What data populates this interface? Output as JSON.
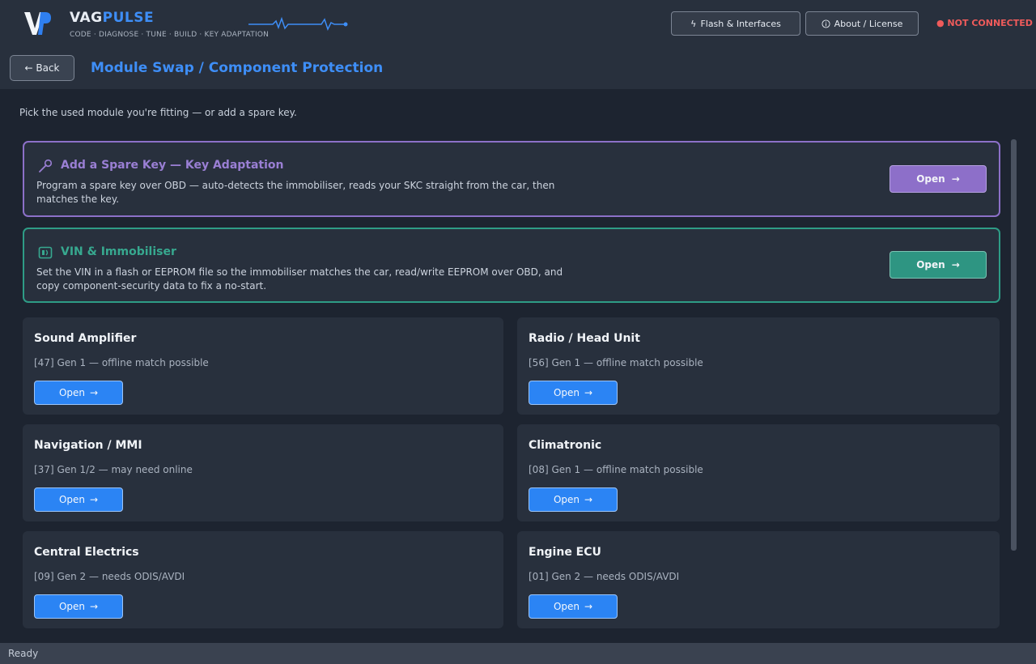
{
  "header": {
    "brand_part1": "VAG",
    "brand_part2": "PULSE",
    "tagline": "CODE · DIAGNOSE · TUNE · BUILD · KEY ADAPTATION",
    "flash_button": "Flash & Interfaces",
    "about_button": "About / License",
    "connection_status": "● NOT CONNECTED",
    "logo": "vp-logo",
    "pulse_graphic": "heartbeat-line"
  },
  "nav": {
    "back_label": "← Back",
    "page_title": "Module Swap / Component Protection"
  },
  "intro": "Pick the used module you're fitting — or add a spare key.",
  "features": [
    {
      "title": "Add a Spare Key — Key Adaptation",
      "description": "Program a spare key over OBD — auto-detects the immobiliser, reads your SKC straight from the car, then matches the key.",
      "button": "Open",
      "arrow": "→",
      "icon": "wrench-icon"
    },
    {
      "title": "VIN & Immobiliser",
      "description": "Set the VIN in a flash or EEPROM file so the immobiliser matches the car, read/write EEPROM over OBD, and copy component-security data to fix a no-start.",
      "button": "Open",
      "arrow": "→",
      "icon": "id-card-icon"
    }
  ],
  "modules": [
    {
      "title": "Sound Amplifier",
      "description": "[47] Gen 1 — offline match possible",
      "button": "Open",
      "arrow": "→"
    },
    {
      "title": "Radio / Head Unit",
      "description": "[56] Gen 1 — offline match possible",
      "button": "Open",
      "arrow": "→"
    },
    {
      "title": "Navigation / MMI",
      "description": "[37] Gen 1/2 — may need online",
      "button": "Open",
      "arrow": "→"
    },
    {
      "title": "Climatronic",
      "description": "[08] Gen 1 — offline match possible",
      "button": "Open",
      "arrow": "→"
    },
    {
      "title": "Central Electrics",
      "description": "[09] Gen 2 — needs ODIS/AVDI",
      "button": "Open",
      "arrow": "→"
    },
    {
      "title": "Engine ECU",
      "description": "[01] Gen 2 — needs ODIS/AVDI",
      "button": "Open",
      "arrow": "→"
    }
  ],
  "status_bar": "Ready",
  "colors": {
    "accent": "#3e8ef7",
    "key_feature": "#8c70c8",
    "vin_feature": "#2e9c86",
    "error": "#f05b5b"
  }
}
